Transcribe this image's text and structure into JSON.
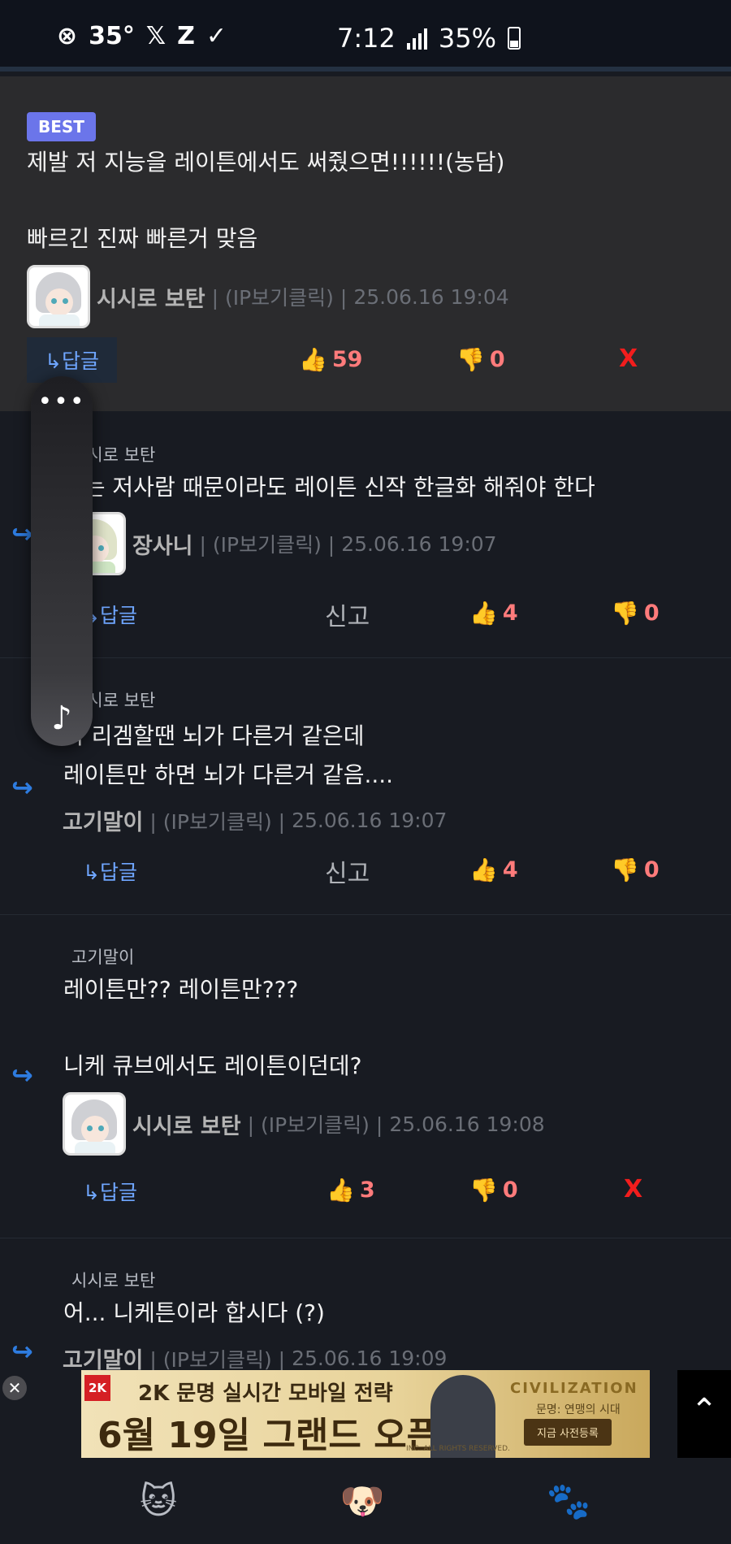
{
  "status_bar": {
    "icons": [
      "⊗",
      "35°",
      "𝕏",
      "Z",
      "✓"
    ],
    "time": "7:12",
    "battery": "35%"
  },
  "comments": [
    {
      "best_badge": "BEST",
      "text_lines": [
        "제발 저 지능을 레이튼에서도 써줬으면!!!!!!(농담)",
        "",
        "빠르긴 진짜 빠른거 맞음"
      ],
      "nickname": "시시로 보탄",
      "ip": "| (IP보기클릭) |",
      "datetime": "25.06.16 19:04",
      "reply_label": "↳답글",
      "likes": "59",
      "dislikes": "0",
      "delete_label": "X"
    },
    {
      "mention": "시시로 보탄",
      "text_lines": [
        "파는 저사람 때문이라도 레이튼 신작 한글화 해줘야 한다"
      ],
      "nickname": "장사니",
      "ip": "| (IP보기클릭) |",
      "datetime": "25.06.16 19:07",
      "reply_label": "↳답글",
      "report_label": "신고",
      "likes": "4",
      "dislikes": "0"
    },
    {
      "mention": "시시로 보탄",
      "text_lines": [
        "짜 리겜할땐 뇌가 다른거 같은데",
        "레이튼만 하면 뇌가 다른거 같음...."
      ],
      "nickname": "고기말이",
      "ip": "| (IP보기클릭) |",
      "datetime": "25.06.16 19:07",
      "reply_label": "↳답글",
      "report_label": "신고",
      "likes": "4",
      "dislikes": "0"
    },
    {
      "mention": "고기말이",
      "text_lines": [
        "레이튼만?? 레이튼만???",
        "",
        "니케 큐브에서도 레이튼이던데?"
      ],
      "nickname": "시시로 보탄",
      "ip": "| (IP보기클릭) |",
      "datetime": "25.06.16 19:08",
      "reply_label": "↳답글",
      "likes": "3",
      "dislikes": "0",
      "delete_label": "X"
    },
    {
      "mention": "시시로 보탄",
      "text_lines": [
        "어... 니케튼이라 합시다 (?)"
      ],
      "nickname": "고기말이",
      "ip": "| (IP보기클릭) |",
      "datetime": "25.06.16 19:09"
    }
  ],
  "ad": {
    "logo": "2K",
    "line1": "2K 문명 실시간 모바일 전략",
    "line2": "6월 19일 그랜드 오픈",
    "brand": "CIVILIZATION",
    "sub": "문명: 연맹의 시대",
    "cta": "지금 사전등록",
    "fine": "INC. ALL RIGHTS RESERVED."
  },
  "icons": {
    "reply_arrow": "↪",
    "thumb_up": "👍",
    "thumb_down": "👎",
    "scroll_top": "⌃",
    "close": "✕",
    "floating_menu": "•••",
    "music_note": "♪",
    "nav": [
      "🐱",
      "🐶",
      "🐾"
    ]
  }
}
